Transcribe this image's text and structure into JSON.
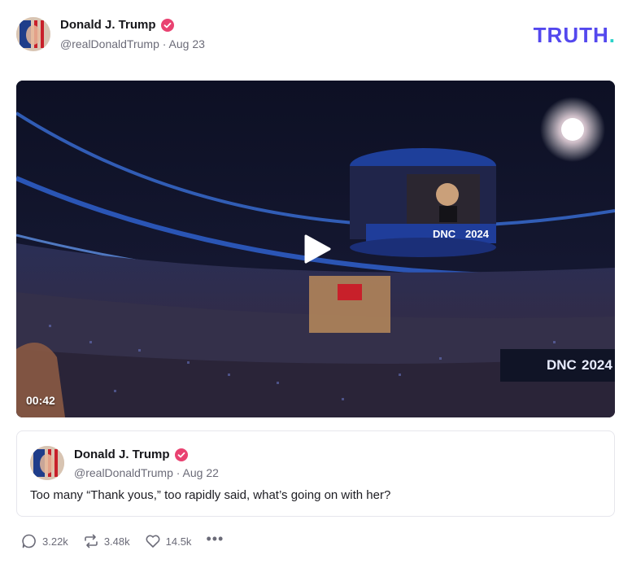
{
  "brand": {
    "logo_text": "TRUTH",
    "logo_dot": ".",
    "logo_color": "#5448ee",
    "dot_color": "#2ad2c9"
  },
  "post": {
    "author_name": "Donald J. Trump",
    "handle": "@realDonaldTrump",
    "separator": "·",
    "date": "Aug 23",
    "verified_color": "#e94271"
  },
  "video": {
    "duration": "00:42",
    "screen_text_1": "DNC",
    "screen_text_2": "2024",
    "screen_text_3": "DNC",
    "screen_text_4": "2024"
  },
  "quote": {
    "author_name": "Donald J. Trump",
    "handle": "@realDonaldTrump",
    "separator": "·",
    "date": "Aug 22",
    "text": "Too many “Thank yous,” too rapidly said, what’s going on with her?"
  },
  "actions": {
    "replies": "3.22k",
    "reposts": "3.48k",
    "likes": "14.5k",
    "more": "•••"
  }
}
